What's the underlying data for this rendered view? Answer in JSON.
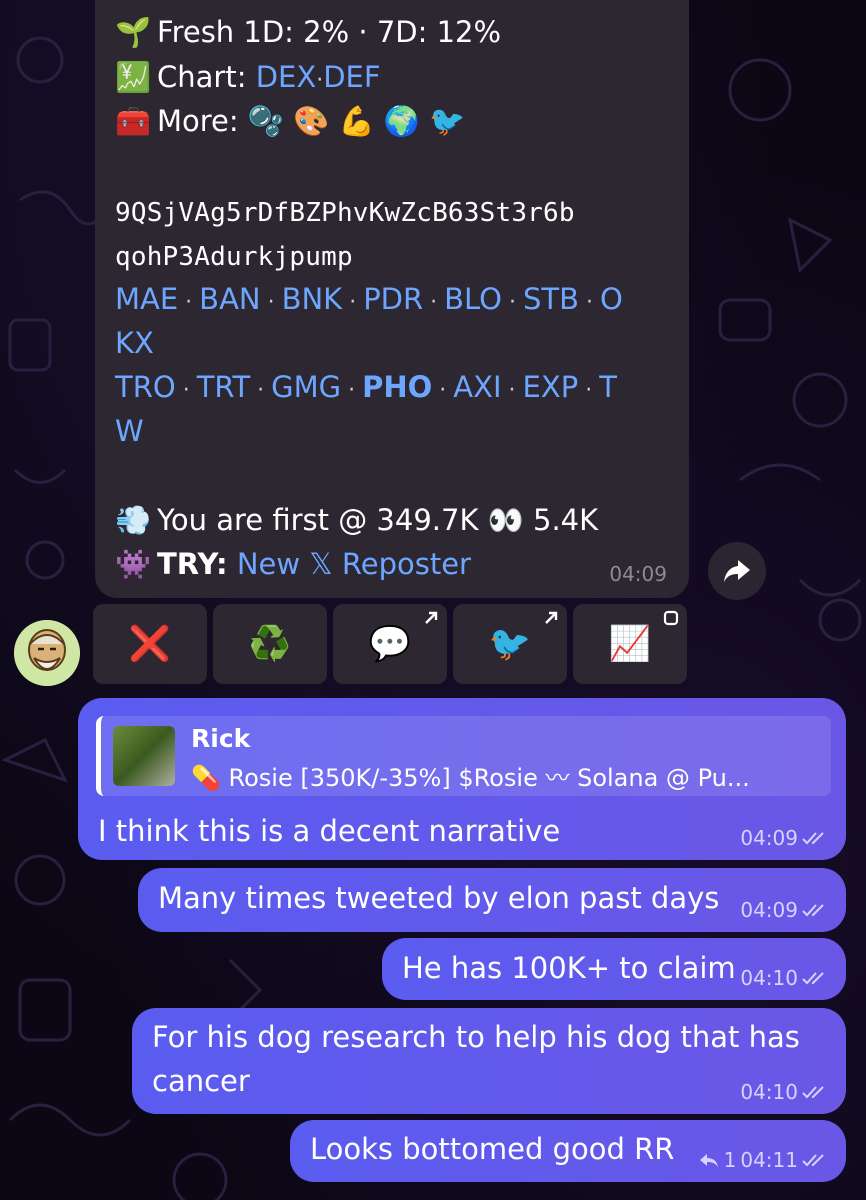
{
  "bot_message": {
    "fresh_line": "Fresh 1D: 2% · 7D: 12%",
    "fresh_icon": "🌱",
    "chart_icon": "💹",
    "chart_label": "Chart:",
    "chart_links": [
      "DEX",
      "DEF"
    ],
    "more_icon": "🧰",
    "more_label": "More:",
    "more_emojis": [
      "🫧",
      "🎨",
      "💪",
      "🌍",
      "🐦"
    ],
    "address_line1": "9QSjVAg5rDfBZPhvKwZcB63St3r6b",
    "address_line2": "qohP3Adurkjpump",
    "links_row1": [
      "MAE",
      "BAN",
      "BNK",
      "PDR",
      "BLO",
      "STB",
      "O"
    ],
    "links_row1_wrap": "KX",
    "links_row2": [
      "TRO",
      "TRT",
      "GMG",
      "PHO",
      "AXI",
      "EXP",
      "T"
    ],
    "links_row2_wrap": "W",
    "first_icon": "💨",
    "first_text": "You are first @ 349.7K",
    "eyes_icon": "👀",
    "views": "5.4K",
    "try_icon": "👾",
    "try_label": "TRY:",
    "try_link": "New 𝕏 Reposter",
    "time": "04:09"
  },
  "keyboard": [
    {
      "icon": "❌",
      "name": "close"
    },
    {
      "icon": "♻️",
      "name": "recycle"
    },
    {
      "icon": "💬",
      "name": "chat"
    },
    {
      "icon": "🐦",
      "name": "bird"
    },
    {
      "icon": "📈",
      "name": "chart"
    }
  ],
  "reply": {
    "name": "Rick",
    "text": "💊 Rosie [350K/-35%] $Rosie 〰 Solana @ Pu..."
  },
  "messages": [
    {
      "text": "I think this is a decent narrative",
      "time": "04:09"
    },
    {
      "text": "Many times tweeted by elon past days",
      "time": "04:09"
    },
    {
      "text": "He has 100K+ to claim",
      "time": "04:10"
    },
    {
      "text_line1": "For his dog research to help his dog that has",
      "text_line2": "cancer",
      "time": "04:10"
    },
    {
      "text": "Looks bottomed good RR",
      "reply_count": "1",
      "time": "04:11"
    }
  ],
  "colors": {
    "bubble_in": "#2c2730",
    "bubble_out": "#5a5cf0",
    "link": "#6ea6ff",
    "background": "#0b0714"
  }
}
